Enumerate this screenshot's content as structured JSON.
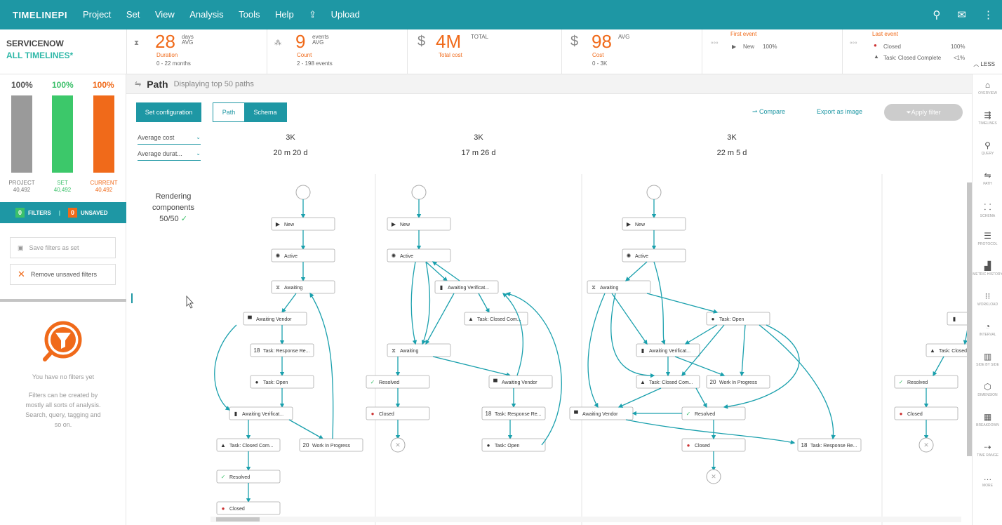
{
  "app": {
    "logo": "TIMELINEPI"
  },
  "menu": [
    "Project",
    "Set",
    "View",
    "Analysis",
    "Tools",
    "Help",
    "Upload"
  ],
  "topicons": [
    "search-icon",
    "mail-icon",
    "more-icon"
  ],
  "project": {
    "name": "SERVICENOW",
    "timelines": "ALL TIMELINES*"
  },
  "kpis": {
    "duration": {
      "value": "28",
      "unit1": "days",
      "unit2": "AVG",
      "label": "Duration",
      "sub": "0 - 22 months"
    },
    "count": {
      "value": "9",
      "unit1": "events",
      "unit2": "AVG",
      "label": "Count",
      "sub": "2 - 198 events"
    },
    "total": {
      "currency": "$",
      "value": "4M",
      "unit": "TOTAL",
      "label": "Total cost"
    },
    "cost": {
      "currency": "$",
      "value": "98",
      "unit": "AVG",
      "label": "Cost",
      "sub": "0 - 3K"
    },
    "first": {
      "title": "First event",
      "name": "New",
      "pct": "100%"
    },
    "last": {
      "title": "Last event",
      "r1name": "Closed",
      "r1pct": "100%",
      "r2name": "Task: Closed Complete",
      "r2pct": "<1%"
    },
    "less": "LESS"
  },
  "left": {
    "bars": [
      {
        "pct": "100%",
        "label": "PROJECT",
        "count": "40,492",
        "color": "#9a9a9a",
        "fill": 1
      },
      {
        "pct": "100%",
        "label": "SET",
        "count": "40,492",
        "color": "#3cc86a",
        "fill": 1
      },
      {
        "pct": "100%",
        "label": "CURRENT",
        "count": "40,492",
        "color": "#f06a1a",
        "fill": 1
      }
    ],
    "filters": {
      "count": "0",
      "label": "FILTERS",
      "unsaved_count": "0",
      "unsaved": "UNSAVED"
    },
    "save": "Save filters as set",
    "remove": "Remove unsaved filters",
    "nofilters": "You have no filters yet",
    "hint1": "Filters can be created by",
    "hint2": "mostly all sorts of analysis.",
    "hint3": "Search, query, tagging and",
    "hint4": "so on."
  },
  "main": {
    "title": "Path",
    "subtitle": "Displaying top 50 paths",
    "setconf": "Set configuration",
    "tab_path": "Path",
    "tab_schema": "Schema",
    "compare": "Compare",
    "export": "Export as image",
    "apply": "Apply filter",
    "sel1": "Average cost",
    "sel2": "Average durat...",
    "rendering1": "Rendering",
    "rendering2": "components",
    "rendering3": "50/50",
    "columns": [
      {
        "cost": "3K",
        "dur": "20 m 20 d"
      },
      {
        "cost": "3K",
        "dur": "17 m 26 d"
      },
      {
        "cost": "3K",
        "dur": "22 m 5 d"
      }
    ]
  },
  "nodes": {
    "new": "New",
    "active": "Active",
    "awaiting": "Awaiting",
    "awaiting_vendor": "Awaiting Vendor",
    "task_resp": "Task: Response Re...",
    "task_open": "Task: Open",
    "awaiting_verif": "Awaiting Verificat...",
    "task_closed": "Task: Closed Com...",
    "wip": "Work In Progress",
    "resolved": "Resolved",
    "closed": "Closed",
    "task_closed_co": "Task: Closed Co",
    "count_18": "18",
    "count_20": "20"
  },
  "nav": [
    "OVERVIEW",
    "TIMELINES",
    "QUERY",
    "PATH",
    "SCHEMA",
    "PROTOCOL",
    "METRIC HISTORY",
    "WORKLOAD",
    "INTERVAL",
    "SIDE BY SIDE",
    "DIMENSION",
    "BREAKDOWN",
    "TIME RANGE",
    "MORE"
  ]
}
